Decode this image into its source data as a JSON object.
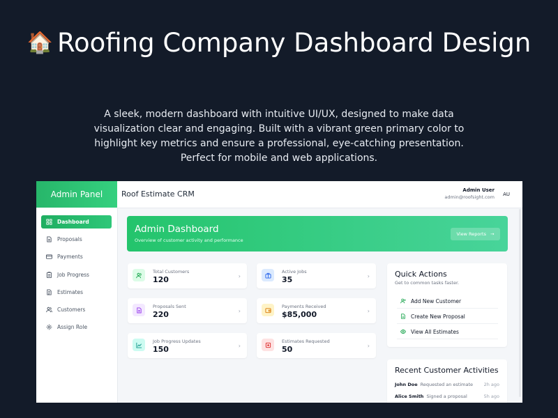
{
  "hero": {
    "icon": "house-emoji",
    "title": "Roofing Company Dashboard Design",
    "description": "A sleek, modern dashboard with intuitive UI/UX, designed to make data visualization clear and engaging. Built with a vibrant green primary color to highlight key metrics and ensure a professional, eye-catching presentation. Perfect for mobile and web applications."
  },
  "app": {
    "brand": "Admin Panel",
    "title": "Roof Estimate CRM",
    "user": {
      "name": "Admin User",
      "email": "admin@roofsight.com",
      "initials": "AU"
    },
    "sidebar": [
      {
        "label": "Dashboard",
        "icon": "grid-icon",
        "active": true
      },
      {
        "label": "Proposals",
        "icon": "document-icon",
        "active": false
      },
      {
        "label": "Payments",
        "icon": "credit-card-icon",
        "active": false
      },
      {
        "label": "Job Progress",
        "icon": "clipboard-icon",
        "active": false
      },
      {
        "label": "Estimates",
        "icon": "file-icon",
        "active": false
      },
      {
        "label": "Customers",
        "icon": "users-icon",
        "active": false
      },
      {
        "label": "Assign Role",
        "icon": "gear-icon",
        "active": false
      }
    ],
    "banner": {
      "title": "Admin Dashboard",
      "subtitle": "Overview of customer activity and performance",
      "button": "View Reports"
    },
    "stats": [
      {
        "label": "Total Customers",
        "value": "120",
        "icon": "users-icon",
        "color": "#22c55e"
      },
      {
        "label": "Active Jobs",
        "value": "35",
        "icon": "briefcase-icon",
        "color": "#3b82f6"
      },
      {
        "label": "Proposals Sent",
        "value": "220",
        "icon": "document-icon",
        "color": "#a855f7"
      },
      {
        "label": "Payments Received",
        "value": "$85,000",
        "icon": "wallet-icon",
        "color": "#f59e0b"
      },
      {
        "label": "Job Progress Updates",
        "value": "150",
        "icon": "chart-icon",
        "color": "#14b8a6"
      },
      {
        "label": "Estimates Requested",
        "value": "50",
        "icon": "plus-square-icon",
        "color": "#ef4444"
      }
    ],
    "quick_actions": {
      "title": "Quick Actions",
      "subtitle": "Get to common tasks faster.",
      "items": [
        {
          "label": "Add New Customer",
          "icon": "user-plus-icon"
        },
        {
          "label": "Create New Proposal",
          "icon": "document-icon"
        },
        {
          "label": "View All Estimates",
          "icon": "eye-icon"
        }
      ]
    },
    "recent": {
      "title": "Recent Customer Activities",
      "items": [
        {
          "name": "John Doe",
          "action": "Requested an estimate",
          "time": "2h ago"
        },
        {
          "name": "Alice Smith",
          "action": "Signed a proposal",
          "time": "5h ago"
        }
      ]
    },
    "colors": {
      "primary": "#22c55e",
      "background": "#131b29"
    }
  }
}
